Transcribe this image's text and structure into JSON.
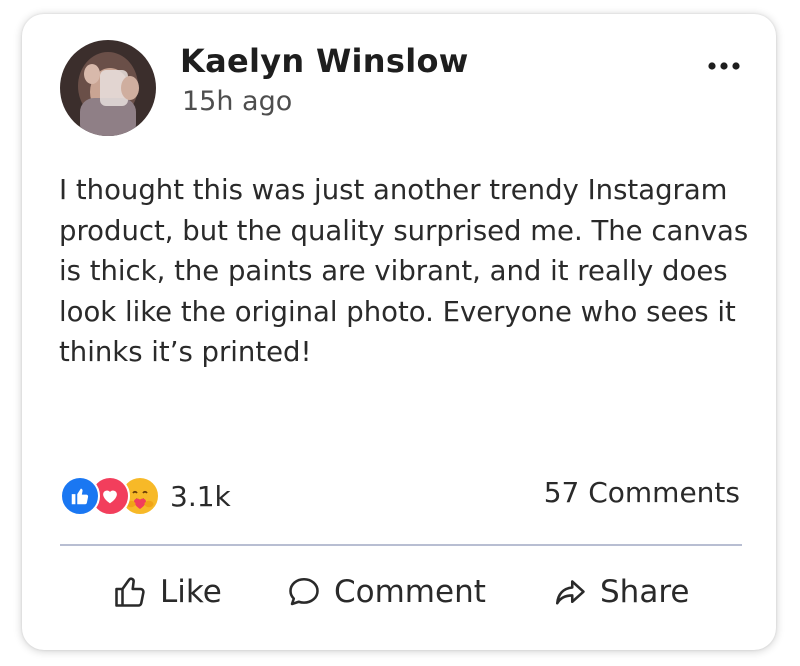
{
  "post": {
    "author": "Kaelyn Winslow",
    "timestamp": "15h ago",
    "text": "I thought this was just another trendy Instagram product, but the quality surprised me. The canvas is thick, the paints are vibrant, and it really does look like the original photo. Everyone who sees it thinks it’s printed!",
    "more_icon": "more-options-icon"
  },
  "stats": {
    "reaction_icons": [
      "like-reaction-icon",
      "love-reaction-icon",
      "care-reaction-icon"
    ],
    "reactions_count": "3.1k",
    "comments_count": "57 Comments"
  },
  "actions": {
    "like": {
      "label": "Like",
      "icon": "thumbs-up-icon"
    },
    "comment": {
      "label": "Comment",
      "icon": "comment-icon"
    },
    "share": {
      "label": "Share",
      "icon": "share-icon"
    }
  },
  "colors": {
    "like_blue": "#1a77f2",
    "love_red": "#f23e5c",
    "care_yellow": "#f7b928",
    "divider": "#b8bed2"
  }
}
